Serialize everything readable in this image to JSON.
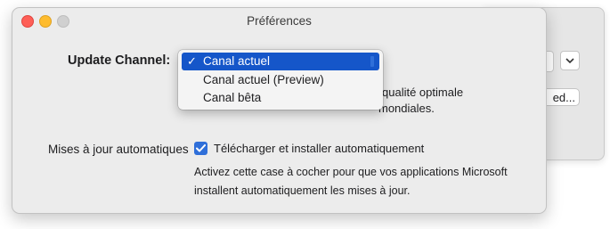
{
  "window": {
    "title": "Préférences"
  },
  "background_window": {
    "button_label": "ed..."
  },
  "update_channel": {
    "label": "Update Channel:",
    "options": [
      {
        "label": "Canal actuel",
        "selected": true
      },
      {
        "label": "Canal actuel (Preview)",
        "selected": false
      },
      {
        "label": "Canal bêta",
        "selected": false
      }
    ],
    "description_line1_fragment": "qualité optimale",
    "description_line2_fragment": "mondiales."
  },
  "auto_updates": {
    "label": "Mises à jour automatiques",
    "checkbox_label": "Télécharger et installer automatiquement",
    "checked": true,
    "help": "Activez cette case à cocher pour que vos applications Microsoft installent automatiquement les mises à jour."
  },
  "colors": {
    "accent": "#1556c9",
    "checkbox": "#2f6fd9"
  }
}
